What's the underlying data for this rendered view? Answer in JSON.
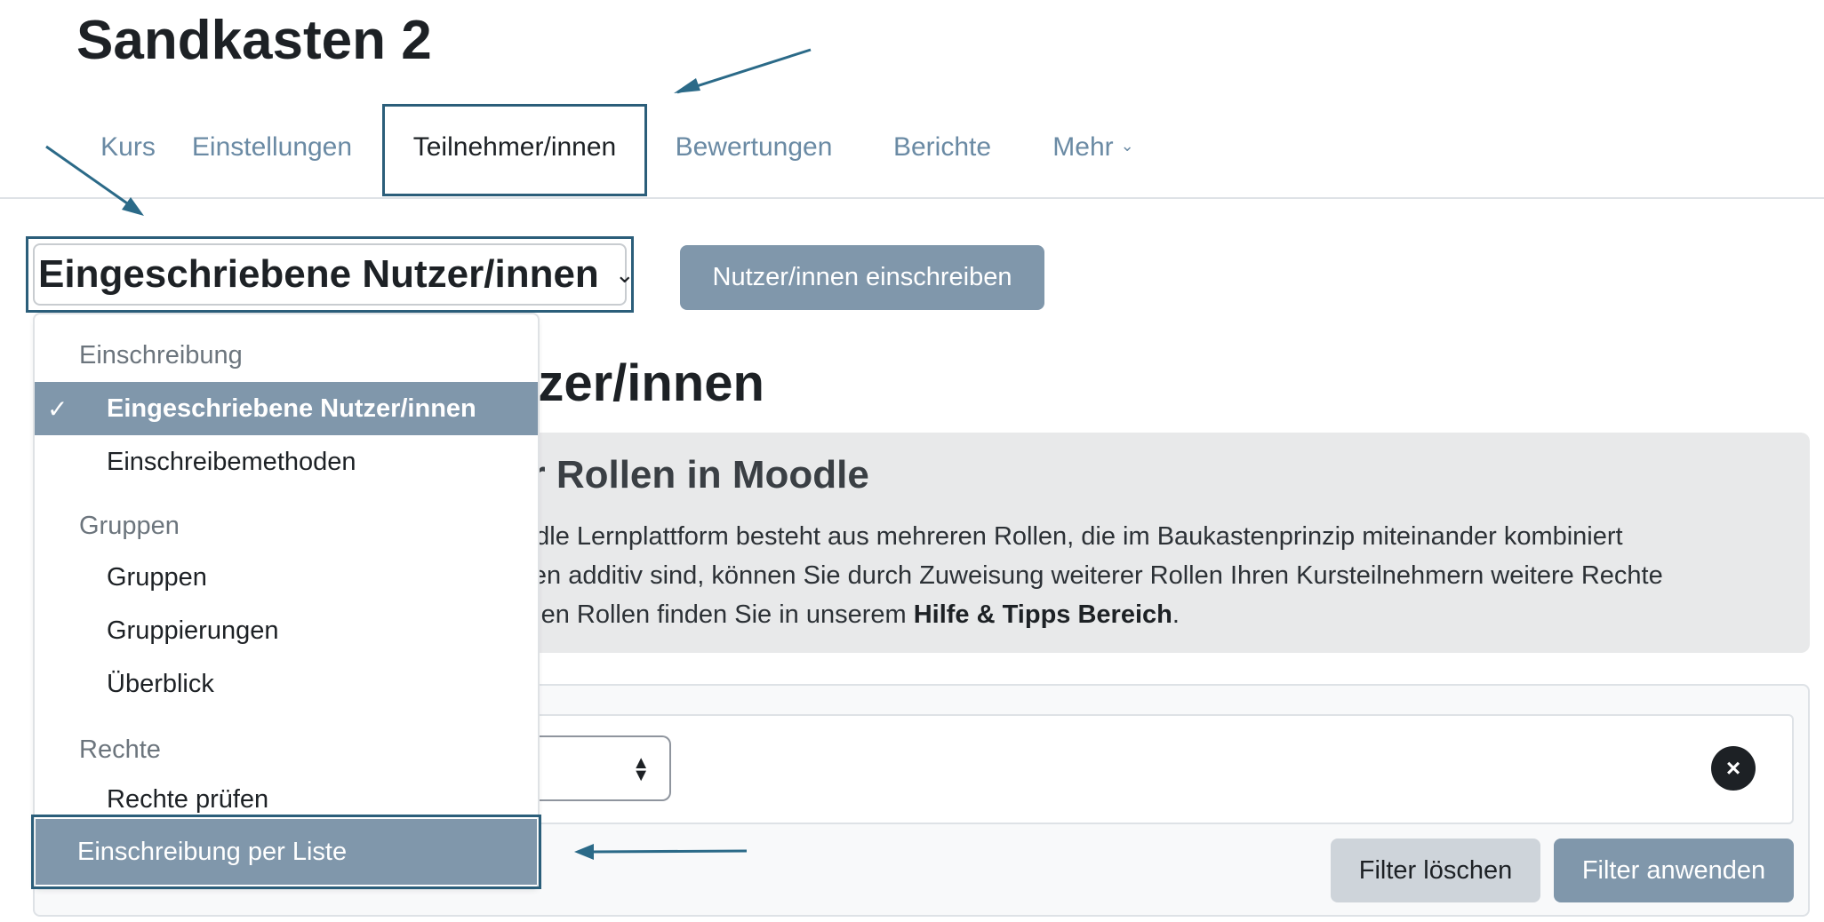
{
  "page": {
    "title": "Sandkasten 2"
  },
  "nav": {
    "items": [
      {
        "label": "Kurs"
      },
      {
        "label": "Einstellungen"
      },
      {
        "label": "Teilnehmer/innen"
      },
      {
        "label": "Bewertungen"
      },
      {
        "label": "Berichte"
      },
      {
        "label": "Mehr"
      }
    ],
    "active": "Teilnehmer/innen"
  },
  "participants_select": {
    "selected": "Eingeschriebene Nutzer/innen"
  },
  "enrol_button": {
    "label": "Nutzer/innen einschreiben"
  },
  "background": {
    "heading_partial": "tzer/innen",
    "info_title_partial": "er Rollen in Moodle",
    "info_lines": [
      "odle Lernplattform besteht aus mehreren Rollen, die im Baukastenprinzip miteinander kombiniert",
      "llen additiv sind, können Sie durch Zuweisung weiterer Rollen Ihren Kursteilnehmern weitere Rechte",
      "lnen Rollen finden Sie in unserem "
    ],
    "info_link": "Hilfe & Tipps Bereich",
    "info_end": "."
  },
  "filters": {
    "clear_label": "Filter löschen",
    "apply_label": "Filter anwenden"
  },
  "dropdown": {
    "groups": [
      {
        "header": "Einschreibung",
        "items": [
          "Eingeschriebene Nutzer/innen",
          "Einschreibemethoden"
        ]
      },
      {
        "header": "Gruppen",
        "items": [
          "Gruppen",
          "Gruppierungen",
          "Überblick"
        ]
      },
      {
        "header": "Rechte",
        "items": [
          "Rechte prüfen"
        ]
      }
    ],
    "last_item": "Einschreibung per Liste",
    "selected_item": "Eingeschriebene Nutzer/innen"
  },
  "colors": {
    "accent": "#8097ab",
    "highlight_border": "#2b5e7a",
    "nav_text": "#6a8aa4"
  }
}
